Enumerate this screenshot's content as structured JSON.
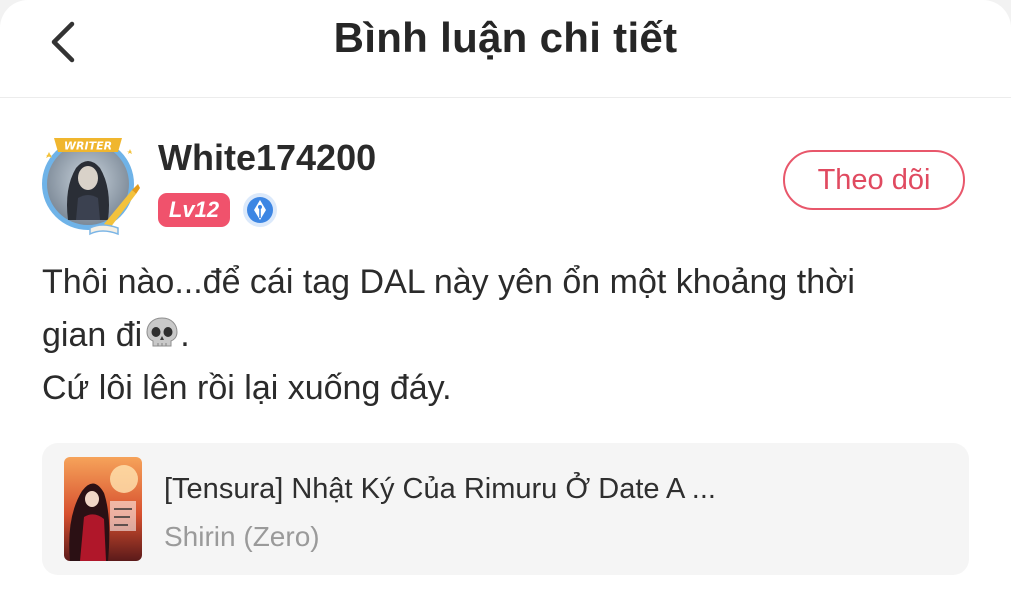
{
  "header": {
    "title": "Bình luận chi tiết",
    "back_icon": "chevron-left-icon"
  },
  "user": {
    "name": "White174200",
    "avatar_frame_label": "WRITER",
    "level": "Lv12",
    "writer_badge_icon": "pen-nib-icon",
    "follow_label": "Theo dõi"
  },
  "comment": {
    "line1": "Thôi nào...để cái tag DAL này yên ổn một khoảng thời",
    "line2": "gian đi",
    "line2_emoji": "skull-emoji",
    "line2_tail": ".",
    "line3": "Cứ lôi lên rồi lại xuống đáy."
  },
  "book": {
    "title": "[Tensura] Nhật Ký Của Rimuru Ở Date A ...",
    "author": "Shirin (Zero)"
  },
  "colors": {
    "accent": "#e8576b",
    "level_badge": "#f0526c",
    "card_bg": "#f5f5f5",
    "secondary_text": "#9a9a9a"
  }
}
